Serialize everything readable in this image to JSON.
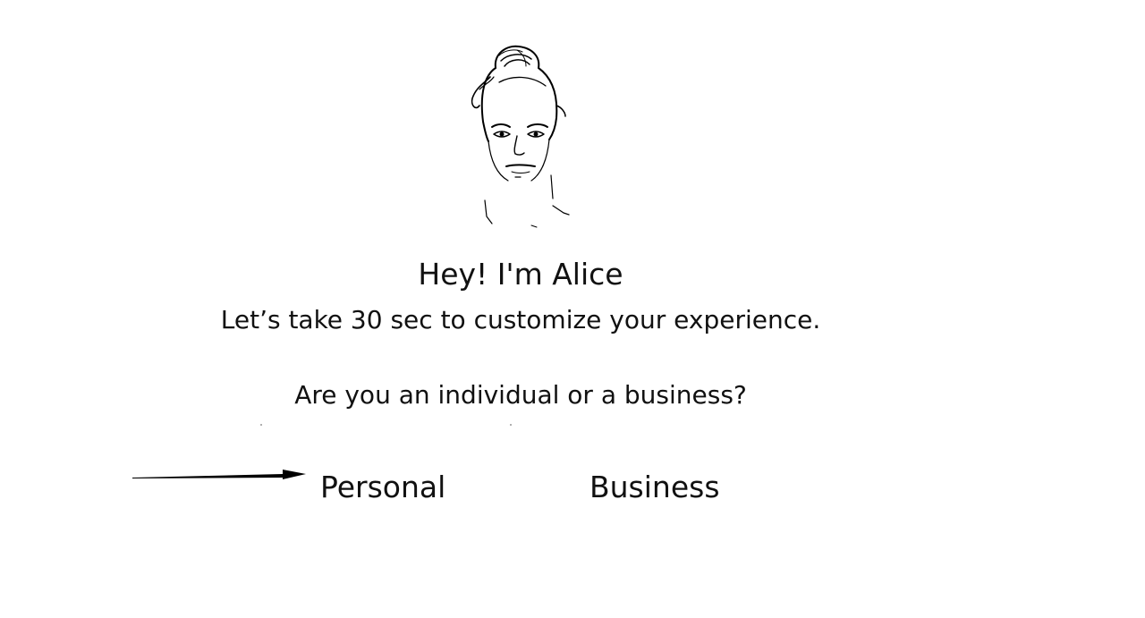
{
  "assistant": {
    "avatar_icon": "woman-sketch-icon",
    "greeting": "Hey! I'm Alice",
    "intro": "Let’s take 30 sec to customize your experience."
  },
  "question": {
    "text": "Are you an individual or a business?"
  },
  "options": {
    "personal_label": "Personal",
    "business_label": "Business",
    "pointer_icon": "arrow-right-icon"
  }
}
